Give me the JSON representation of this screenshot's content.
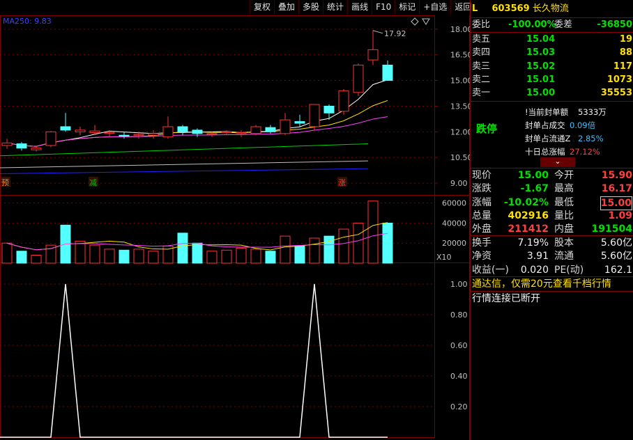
{
  "toolbar": [
    "复权",
    "叠加",
    "多股",
    "统计",
    "画线",
    "F10",
    "标记",
    "+自选",
    "返回"
  ],
  "chart": {
    "ma_label": "MA250: 9.83",
    "high_label": "17.92",
    "price_ticks": [
      "18.00",
      "16.50",
      "15.00",
      "13.50",
      "12.00",
      "10.50",
      "9.00"
    ],
    "vol_ticks": [
      "60000",
      "40000",
      "20000"
    ],
    "vol_unit": "X10",
    "ind_ticks": [
      "1.00",
      "0.80",
      "0.60",
      "0.40",
      "0.20"
    ],
    "markers": [
      "预",
      "减",
      "涨"
    ],
    "candles": [
      {
        "o": 11.2,
        "c": 11.35,
        "h": 11.6,
        "l": 11.0
      },
      {
        "o": 11.3,
        "c": 11.05,
        "h": 11.4,
        "l": 10.9
      },
      {
        "o": 10.95,
        "c": 11.05,
        "h": 11.2,
        "l": 10.85
      },
      {
        "o": 11.2,
        "c": 12.0,
        "h": 12.05,
        "l": 11.1
      },
      {
        "o": 12.3,
        "c": 12.1,
        "h": 13.1,
        "l": 12.0
      },
      {
        "o": 12.0,
        "c": 12.1,
        "h": 12.3,
        "l": 11.8
      },
      {
        "o": 11.95,
        "c": 12.05,
        "h": 12.4,
        "l": 11.8
      },
      {
        "o": 11.9,
        "c": 11.95,
        "h": 12.1,
        "l": 11.7
      },
      {
        "o": 11.8,
        "c": 11.75,
        "h": 12.0,
        "l": 11.6
      },
      {
        "o": 11.8,
        "c": 11.85,
        "h": 12.0,
        "l": 11.6
      },
      {
        "o": 11.8,
        "c": 11.9,
        "h": 12.1,
        "l": 11.6
      },
      {
        "o": 11.7,
        "c": 12.3,
        "h": 12.9,
        "l": 11.6
      },
      {
        "o": 12.3,
        "c": 12.0,
        "h": 12.4,
        "l": 11.8
      },
      {
        "o": 12.1,
        "c": 11.9,
        "h": 12.2,
        "l": 11.7
      },
      {
        "o": 11.85,
        "c": 11.9,
        "h": 12.0,
        "l": 11.7
      },
      {
        "o": 11.95,
        "c": 12.0,
        "h": 12.1,
        "l": 11.8
      },
      {
        "o": 11.9,
        "c": 11.95,
        "h": 12.1,
        "l": 11.7
      },
      {
        "o": 11.9,
        "c": 12.3,
        "h": 12.4,
        "l": 11.8
      },
      {
        "o": 12.25,
        "c": 12.0,
        "h": 12.4,
        "l": 11.9
      },
      {
        "o": 11.9,
        "c": 12.7,
        "h": 13.1,
        "l": 11.8
      },
      {
        "o": 12.6,
        "c": 12.5,
        "h": 13.0,
        "l": 12.3
      },
      {
        "o": 12.3,
        "c": 13.6,
        "h": 13.6,
        "l": 12.1
      },
      {
        "o": 13.5,
        "c": 13.1,
        "h": 13.6,
        "l": 12.7
      },
      {
        "o": 13.2,
        "c": 14.4,
        "h": 14.5,
        "l": 13.0
      },
      {
        "o": 14.3,
        "c": 15.9,
        "h": 16.0,
        "l": 14.1
      },
      {
        "o": 16.2,
        "c": 16.8,
        "h": 17.92,
        "l": 15.9
      },
      {
        "o": 15.9,
        "c": 15.0,
        "h": 16.17,
        "l": 15.0
      }
    ],
    "volumes": [
      20000,
      12000,
      8000,
      18000,
      38000,
      22000,
      18000,
      14000,
      13000,
      14000,
      12000,
      17000,
      30000,
      20000,
      12000,
      13000,
      15000,
      14000,
      12000,
      27000,
      17000,
      25000,
      27000,
      34000,
      40000,
      62000,
      40000
    ],
    "indicator": [
      0,
      0,
      0,
      0,
      1,
      0,
      0,
      0,
      0,
      0,
      0,
      0,
      0,
      0,
      0,
      0,
      0,
      0,
      0,
      0,
      0,
      1,
      0,
      0,
      0,
      0,
      0
    ]
  },
  "panel": {
    "header_letter": "L",
    "code": "603569",
    "name": "长久物流",
    "weibi_label": "委比",
    "weibi": "-100.00%",
    "weicha_label": "委差",
    "weicha": "-36850",
    "asks": [
      {
        "label": "卖五",
        "price": "15.04",
        "vol": "19"
      },
      {
        "label": "卖四",
        "price": "15.03",
        "vol": "88"
      },
      {
        "label": "卖三",
        "price": "15.02",
        "vol": "117"
      },
      {
        "label": "卖二",
        "price": "15.01",
        "vol": "1073"
      },
      {
        "label": "卖一",
        "price": "15.00",
        "vol": "35553"
      }
    ],
    "limit_label": "跌停",
    "seal": [
      {
        "k": "!当前封单额",
        "v": "5333万"
      },
      {
        "k": "封单占成交",
        "v": "0.09倍"
      },
      {
        "k": "封单占流通Z",
        "v": "2.85%"
      },
      {
        "k": "十日总涨幅",
        "v": "27.12%"
      }
    ],
    "collapse": "⌄",
    "stats": [
      {
        "k1": "现价",
        "v1": "15.00",
        "k2": "今开",
        "v2": "15.90"
      },
      {
        "k1": "涨跌",
        "v1": "-1.67",
        "k2": "最高",
        "v2": "16.17"
      },
      {
        "k1": "涨幅",
        "v1": "-10.02%",
        "k2": "最低",
        "v2": "15.00"
      },
      {
        "k1": "总量",
        "v1": "402916",
        "k2": "量比",
        "v2": "1.09"
      },
      {
        "k1": "外盘",
        "v1": "211412",
        "k2": "内盘",
        "v2": "191504"
      }
    ],
    "stats2": [
      {
        "k1": "换手",
        "v1": "7.19%",
        "k2": "股本",
        "v2": "5.60亿"
      },
      {
        "k1": "净资",
        "v1": "3.91",
        "k2": "流通",
        "v2": "5.60亿"
      },
      {
        "k1": "收益(一)",
        "v1": "0.020",
        "k2": "PE(动)",
        "v2": "162.1"
      }
    ],
    "ad": "通达信，仅需20元查看千档行情",
    "conn": "行情连接已断开"
  },
  "colors": {
    "up": "#ff3232",
    "down": "#54ffff",
    "grid": "#800000",
    "green": "#00e000",
    "yellow": "#ffe000"
  }
}
